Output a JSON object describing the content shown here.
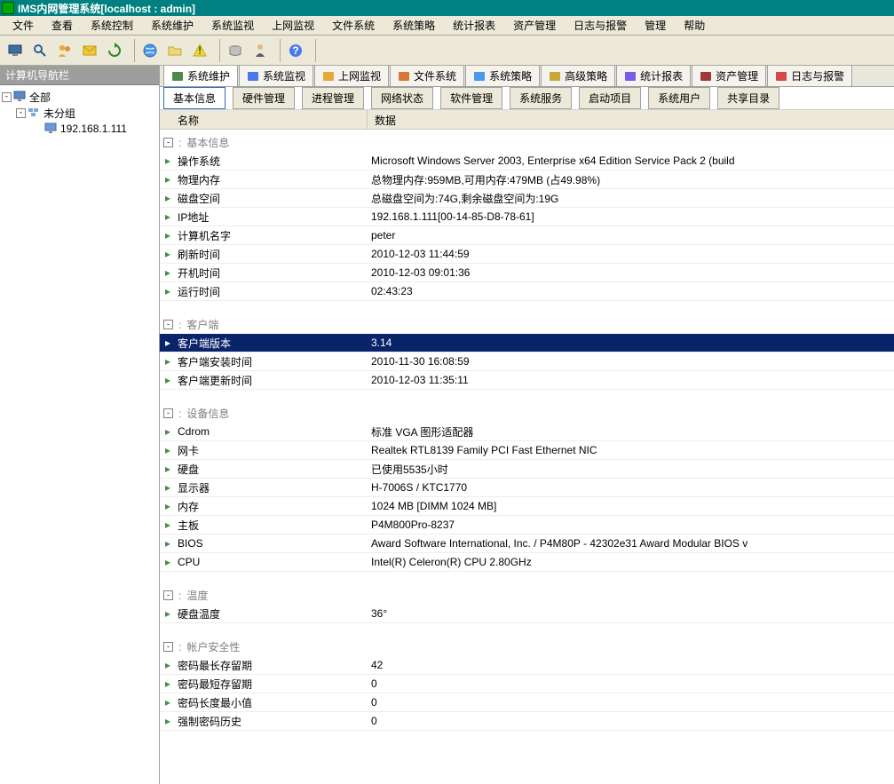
{
  "title_app": "IMS内网管理系统",
  "title_conn": "[localhost : admin]",
  "menubar": [
    "文件",
    "查看",
    "系统控制",
    "系统维护",
    "系统监视",
    "上网监视",
    "文件系统",
    "系统策略",
    "统计报表",
    "资产管理",
    "日志与报警",
    "管理",
    "帮助"
  ],
  "sidebar": {
    "title": "计算机导航栏",
    "all": "全部",
    "ungrouped": "未分组",
    "ip": "192.168.1.111"
  },
  "top_tabs": [
    "系统维护",
    "系统监视",
    "上网监视",
    "文件系统",
    "系统策略",
    "高级策略",
    "统计报表",
    "资产管理",
    "日志与报警"
  ],
  "top_tab_active": 0,
  "sub_tabs": [
    "基本信息",
    "硬件管理",
    "进程管理",
    "网络状态",
    "软件管理",
    "系统服务",
    "启动项目",
    "系统用户",
    "共享目录"
  ],
  "sub_tab_active": 0,
  "grid_headers": {
    "name": "名称",
    "data": "数据"
  },
  "groups": [
    {
      "title": "基本信息",
      "rows": [
        {
          "n": "操作系统",
          "v": "Microsoft Windows Server 2003, Enterprise x64 Edition Service Pack 2 (build"
        },
        {
          "n": "物理内存",
          "v": "总物理内存:959MB,可用内存:479MB (占49.98%)"
        },
        {
          "n": "磁盘空间",
          "v": "总磁盘空间为:74G,剩余磁盘空间为:19G"
        },
        {
          "n": "IP地址",
          "v": "192.168.1.111[00-14-85-D8-78-61]"
        },
        {
          "n": "计算机名字",
          "v": "peter"
        },
        {
          "n": "刷新时间",
          "v": "2010-12-03 11:44:59"
        },
        {
          "n": "开机时间",
          "v": "2010-12-03 09:01:36"
        },
        {
          "n": "运行时间",
          "v": "02:43:23"
        }
      ]
    },
    {
      "title": "客户端",
      "rows": [
        {
          "n": "客户端版本",
          "v": "3.14",
          "sel": true
        },
        {
          "n": "客户端安装时间",
          "v": "2010-11-30 16:08:59"
        },
        {
          "n": "客户端更新时间",
          "v": "2010-12-03 11:35:11"
        }
      ]
    },
    {
      "title": "设备信息",
      "rows": [
        {
          "n": "Cdrom",
          "v": "标准 VGA 图形适配器"
        },
        {
          "n": "网卡",
          "v": "Realtek RTL8139 Family PCI Fast Ethernet NIC"
        },
        {
          "n": "硬盘",
          "v": "  已使用5535小时"
        },
        {
          "n": "显示器",
          "v": "H-7006S  / KTC1770"
        },
        {
          "n": "内存",
          "v": "1024 MB [DIMM 1024 MB]"
        },
        {
          "n": "主板",
          "v": "P4M800Pro-8237"
        },
        {
          "n": "BIOS",
          "v": "Award Software International, Inc. / P4M80P - 42302e31 Award Modular BIOS v"
        },
        {
          "n": "CPU",
          "v": "Intel(R) Celeron(R) CPU 2.80GHz"
        }
      ]
    },
    {
      "title": "温度",
      "rows": [
        {
          "n": "硬盘温度",
          "v": "36°"
        }
      ]
    },
    {
      "title": "帐户安全性",
      "rows": [
        {
          "n": "密码最长存留期",
          "v": "42"
        },
        {
          "n": "密码最短存留期",
          "v": "0"
        },
        {
          "n": "密码长度最小值",
          "v": "0"
        },
        {
          "n": "强制密码历史",
          "v": "0"
        }
      ]
    }
  ]
}
